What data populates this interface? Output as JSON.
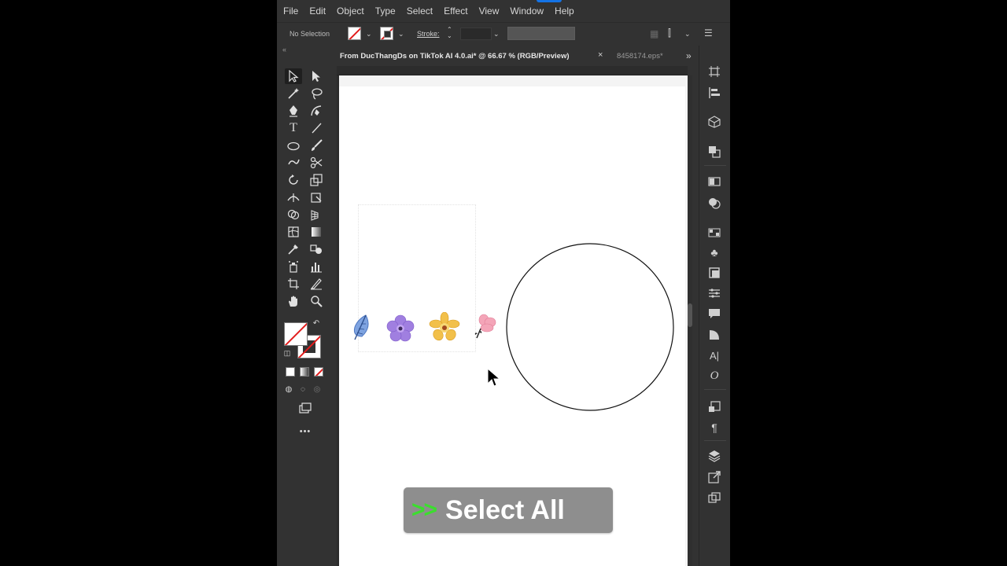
{
  "menu": [
    "File",
    "Edit",
    "Object",
    "Type",
    "Select",
    "Effect",
    "View",
    "Window",
    "Help"
  ],
  "control_bar": {
    "selection_status": "No Selection",
    "stroke_label": "Stroke:"
  },
  "tabs": {
    "active": "From DucThangDs on TikTok AI 4.0.ai* @ 66.67 % (RGB/Preview)",
    "close": "×",
    "inactive": "8458174.eps*",
    "overflow": "»"
  },
  "tools": [
    "selection-tool-icon",
    "direct-selection-tool-icon",
    "magic-wand-tool-icon",
    "lasso-tool-icon",
    "pen-tool-icon",
    "curvature-tool-icon",
    "type-tool-icon",
    "line-segment-tool-icon",
    "ellipse-tool-icon",
    "paintbrush-tool-icon",
    "shaper-tool-icon",
    "scissors-tool-icon",
    "rotate-tool-icon",
    "scale-tool-icon",
    "width-tool-icon",
    "free-transform-tool-icon",
    "shape-builder-tool-icon",
    "perspective-grid-tool-icon",
    "mesh-tool-icon",
    "gradient-tool-icon",
    "eyedropper-tool-icon",
    "blend-tool-icon",
    "symbol-sprayer-tool-icon",
    "column-graph-tool-icon",
    "artboard-tool-icon",
    "slice-tool-icon",
    "hand-tool-icon",
    "zoom-tool-icon"
  ],
  "more_tools": "•••",
  "canvas": {
    "overlay_arrows": ">>",
    "overlay_text": "Select All"
  },
  "colors": {
    "accent_blue": "#1473e6",
    "none_red": "#e21c1c",
    "overlay_green": "#3bde2e",
    "overlay_bg": "#8e8e8e"
  }
}
